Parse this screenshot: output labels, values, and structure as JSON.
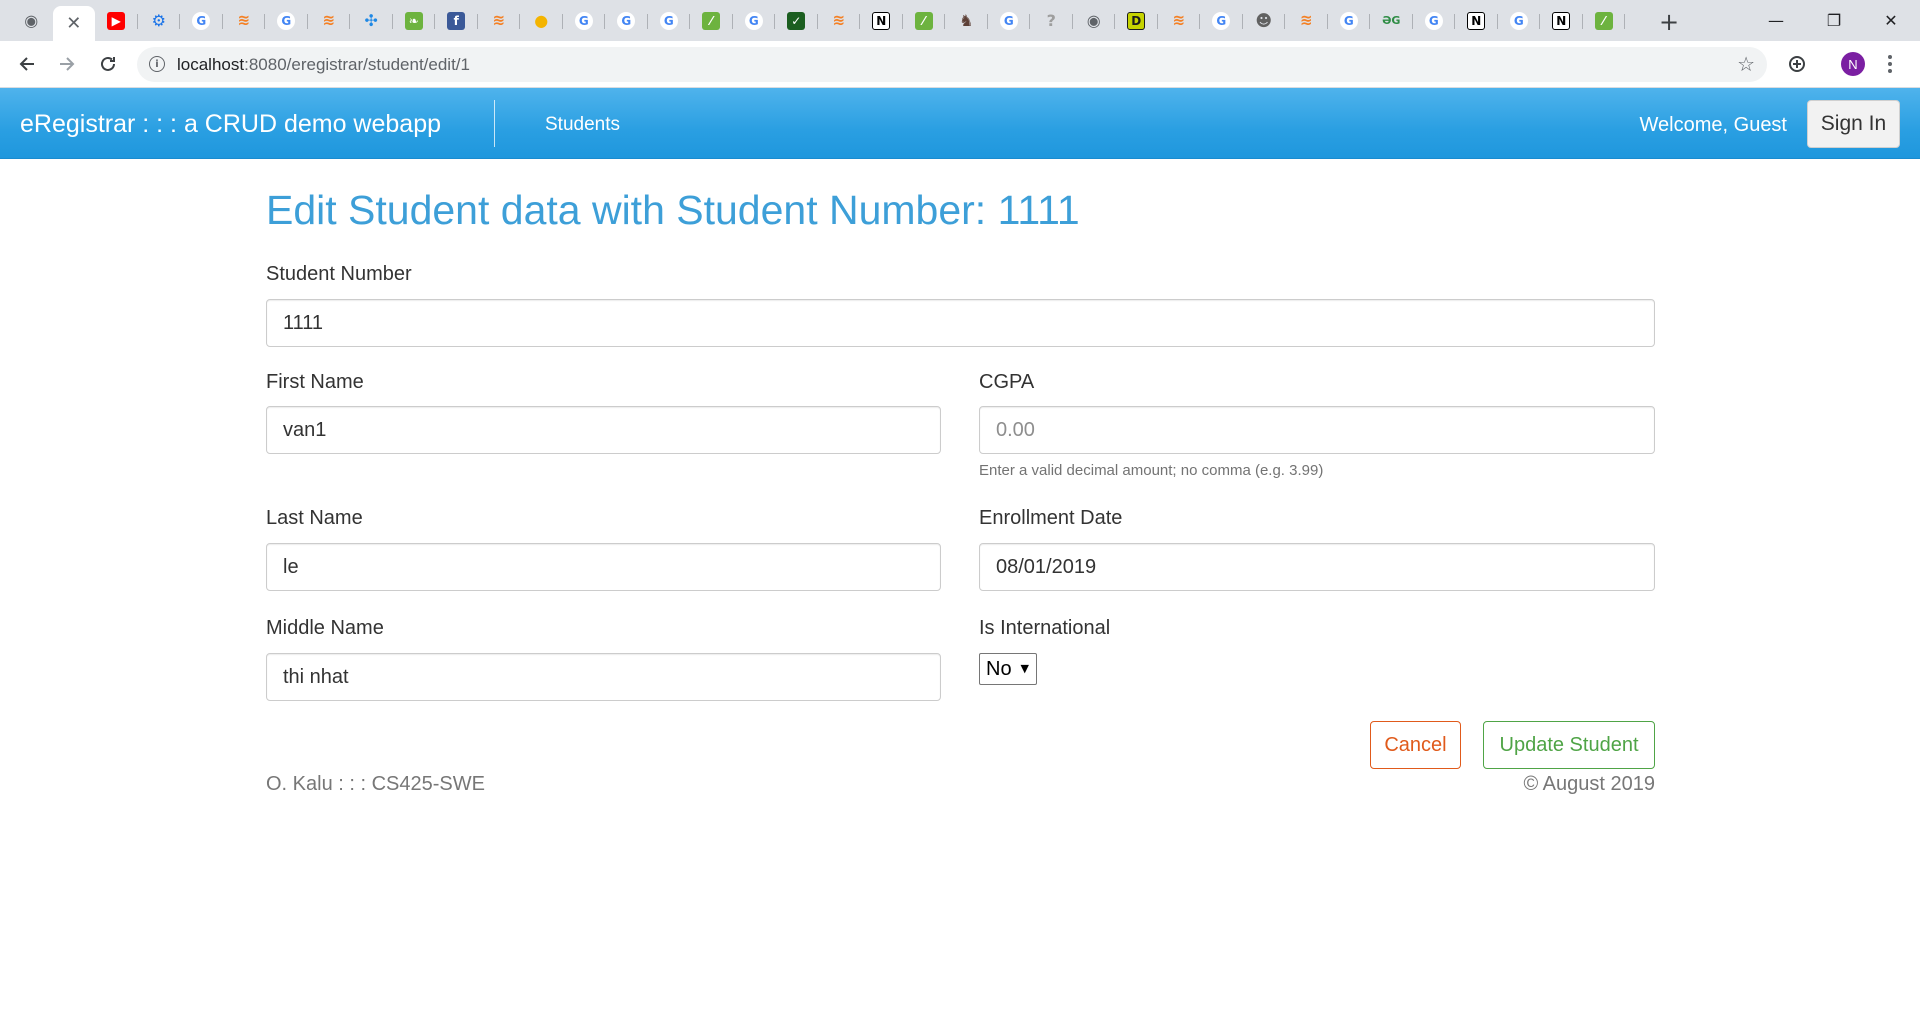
{
  "browser": {
    "tabs": [
      {
        "icon": "globe-icon",
        "color": "#5f6368",
        "glyph": "◉"
      },
      {
        "icon": "close-tab-icon",
        "color": "#5f6368",
        "glyph": "✕",
        "active": true
      },
      {
        "icon": "youtube-icon",
        "color": "#ff0000",
        "glyph": "▶"
      },
      {
        "icon": "settings-gear-icon",
        "color": "#1a73e8",
        "glyph": "⚙"
      },
      {
        "icon": "google-icon",
        "color": "#4285f4",
        "glyph": "G"
      },
      {
        "icon": "stackoverflow-icon",
        "color": "#f48024",
        "glyph": "≋"
      },
      {
        "icon": "google-icon",
        "color": "#4285f4",
        "glyph": "G"
      },
      {
        "icon": "stackoverflow-icon",
        "color": "#f48024",
        "glyph": "≋"
      },
      {
        "icon": "pinwheel-icon",
        "color": "#1e88e5",
        "glyph": "✣"
      },
      {
        "icon": "spring-icon",
        "color": "#6db33f",
        "glyph": "❧"
      },
      {
        "icon": "facebook-icon",
        "color": "#3b5998",
        "glyph": "f"
      },
      {
        "icon": "stackoverflow-icon",
        "color": "#f48024",
        "glyph": "≋"
      },
      {
        "icon": "fruit-icon",
        "color": "#f4b400",
        "glyph": "●"
      },
      {
        "icon": "google-icon",
        "color": "#4285f4",
        "glyph": "G"
      },
      {
        "icon": "google-icon",
        "color": "#4285f4",
        "glyph": "G"
      },
      {
        "icon": "google-icon",
        "color": "#4285f4",
        "glyph": "G"
      },
      {
        "icon": "spring-leaf-icon",
        "color": "#6db33f",
        "glyph": "⁄"
      },
      {
        "icon": "google-icon",
        "color": "#4285f4",
        "glyph": "G"
      },
      {
        "icon": "checkmark-icon",
        "color": "#1b5e20",
        "glyph": "✓"
      },
      {
        "icon": "stackoverflow-icon",
        "color": "#f48024",
        "glyph": "≋"
      },
      {
        "icon": "notion-icon",
        "color": "#000000",
        "glyph": "N"
      },
      {
        "icon": "spring-leaf-icon",
        "color": "#6db33f",
        "glyph": "⁄"
      },
      {
        "icon": "horse-icon",
        "color": "#5d4037",
        "glyph": "♞"
      },
      {
        "icon": "google-icon",
        "color": "#4285f4",
        "glyph": "G"
      },
      {
        "icon": "broken-page-icon",
        "color": "#9e9e9e",
        "glyph": "?"
      },
      {
        "icon": "globe-icon",
        "color": "#5f6368",
        "glyph": "◉"
      },
      {
        "icon": "d-logo-icon",
        "color": "#c6d300",
        "glyph": "D"
      },
      {
        "icon": "stackoverflow-icon",
        "color": "#f48024",
        "glyph": "≋"
      },
      {
        "icon": "google-icon",
        "color": "#4285f4",
        "glyph": "G"
      },
      {
        "icon": "person-icon",
        "color": "#616161",
        "glyph": "☻"
      },
      {
        "icon": "stackoverflow-icon",
        "color": "#f48024",
        "glyph": "≋"
      },
      {
        "icon": "google-icon",
        "color": "#4285f4",
        "glyph": "G"
      },
      {
        "icon": "geeksforgeeks-icon",
        "color": "#2f8d46",
        "glyph": "ƏG"
      },
      {
        "icon": "google-icon",
        "color": "#4285f4",
        "glyph": "G"
      },
      {
        "icon": "notion-icon",
        "color": "#000000",
        "glyph": "N"
      },
      {
        "icon": "google-icon",
        "color": "#4285f4",
        "glyph": "G"
      },
      {
        "icon": "notion-icon",
        "color": "#000000",
        "glyph": "N"
      },
      {
        "icon": "spring-leaf-icon",
        "color": "#6db33f",
        "glyph": "⁄"
      }
    ],
    "url_host": "localhost",
    "url_path": ":8080/eregistrar/student/edit/1",
    "profile_initial": "N"
  },
  "navbar": {
    "brand": "eRegistrar : : : a CRUD demo webapp",
    "students_link": "Students",
    "welcome": "Welcome, Guest",
    "signin": "Sign In",
    "accent": "#2a9fe2"
  },
  "form": {
    "title": "Edit Student data with Student Number: 1111",
    "student_number_label": "Student Number",
    "student_number_value": "1111",
    "first_name_label": "First Name",
    "first_name_value": "van1",
    "cgpa_label": "CGPA",
    "cgpa_placeholder": "0.00",
    "cgpa_help": "Enter a valid decimal amount; no comma (e.g. 3.99)",
    "last_name_label": "Last Name",
    "last_name_value": "le",
    "enrollment_date_label": "Enrollment Date",
    "enrollment_date_value": "08/01/2019",
    "middle_name_label": "Middle Name",
    "middle_name_value": "thi nhat",
    "is_international_label": "Is International",
    "is_international_value": "No",
    "cancel_label": "Cancel",
    "update_label": "Update Student"
  },
  "footer": {
    "left": "O. Kalu : : : CS425-SWE",
    "right": "© August 2019"
  }
}
